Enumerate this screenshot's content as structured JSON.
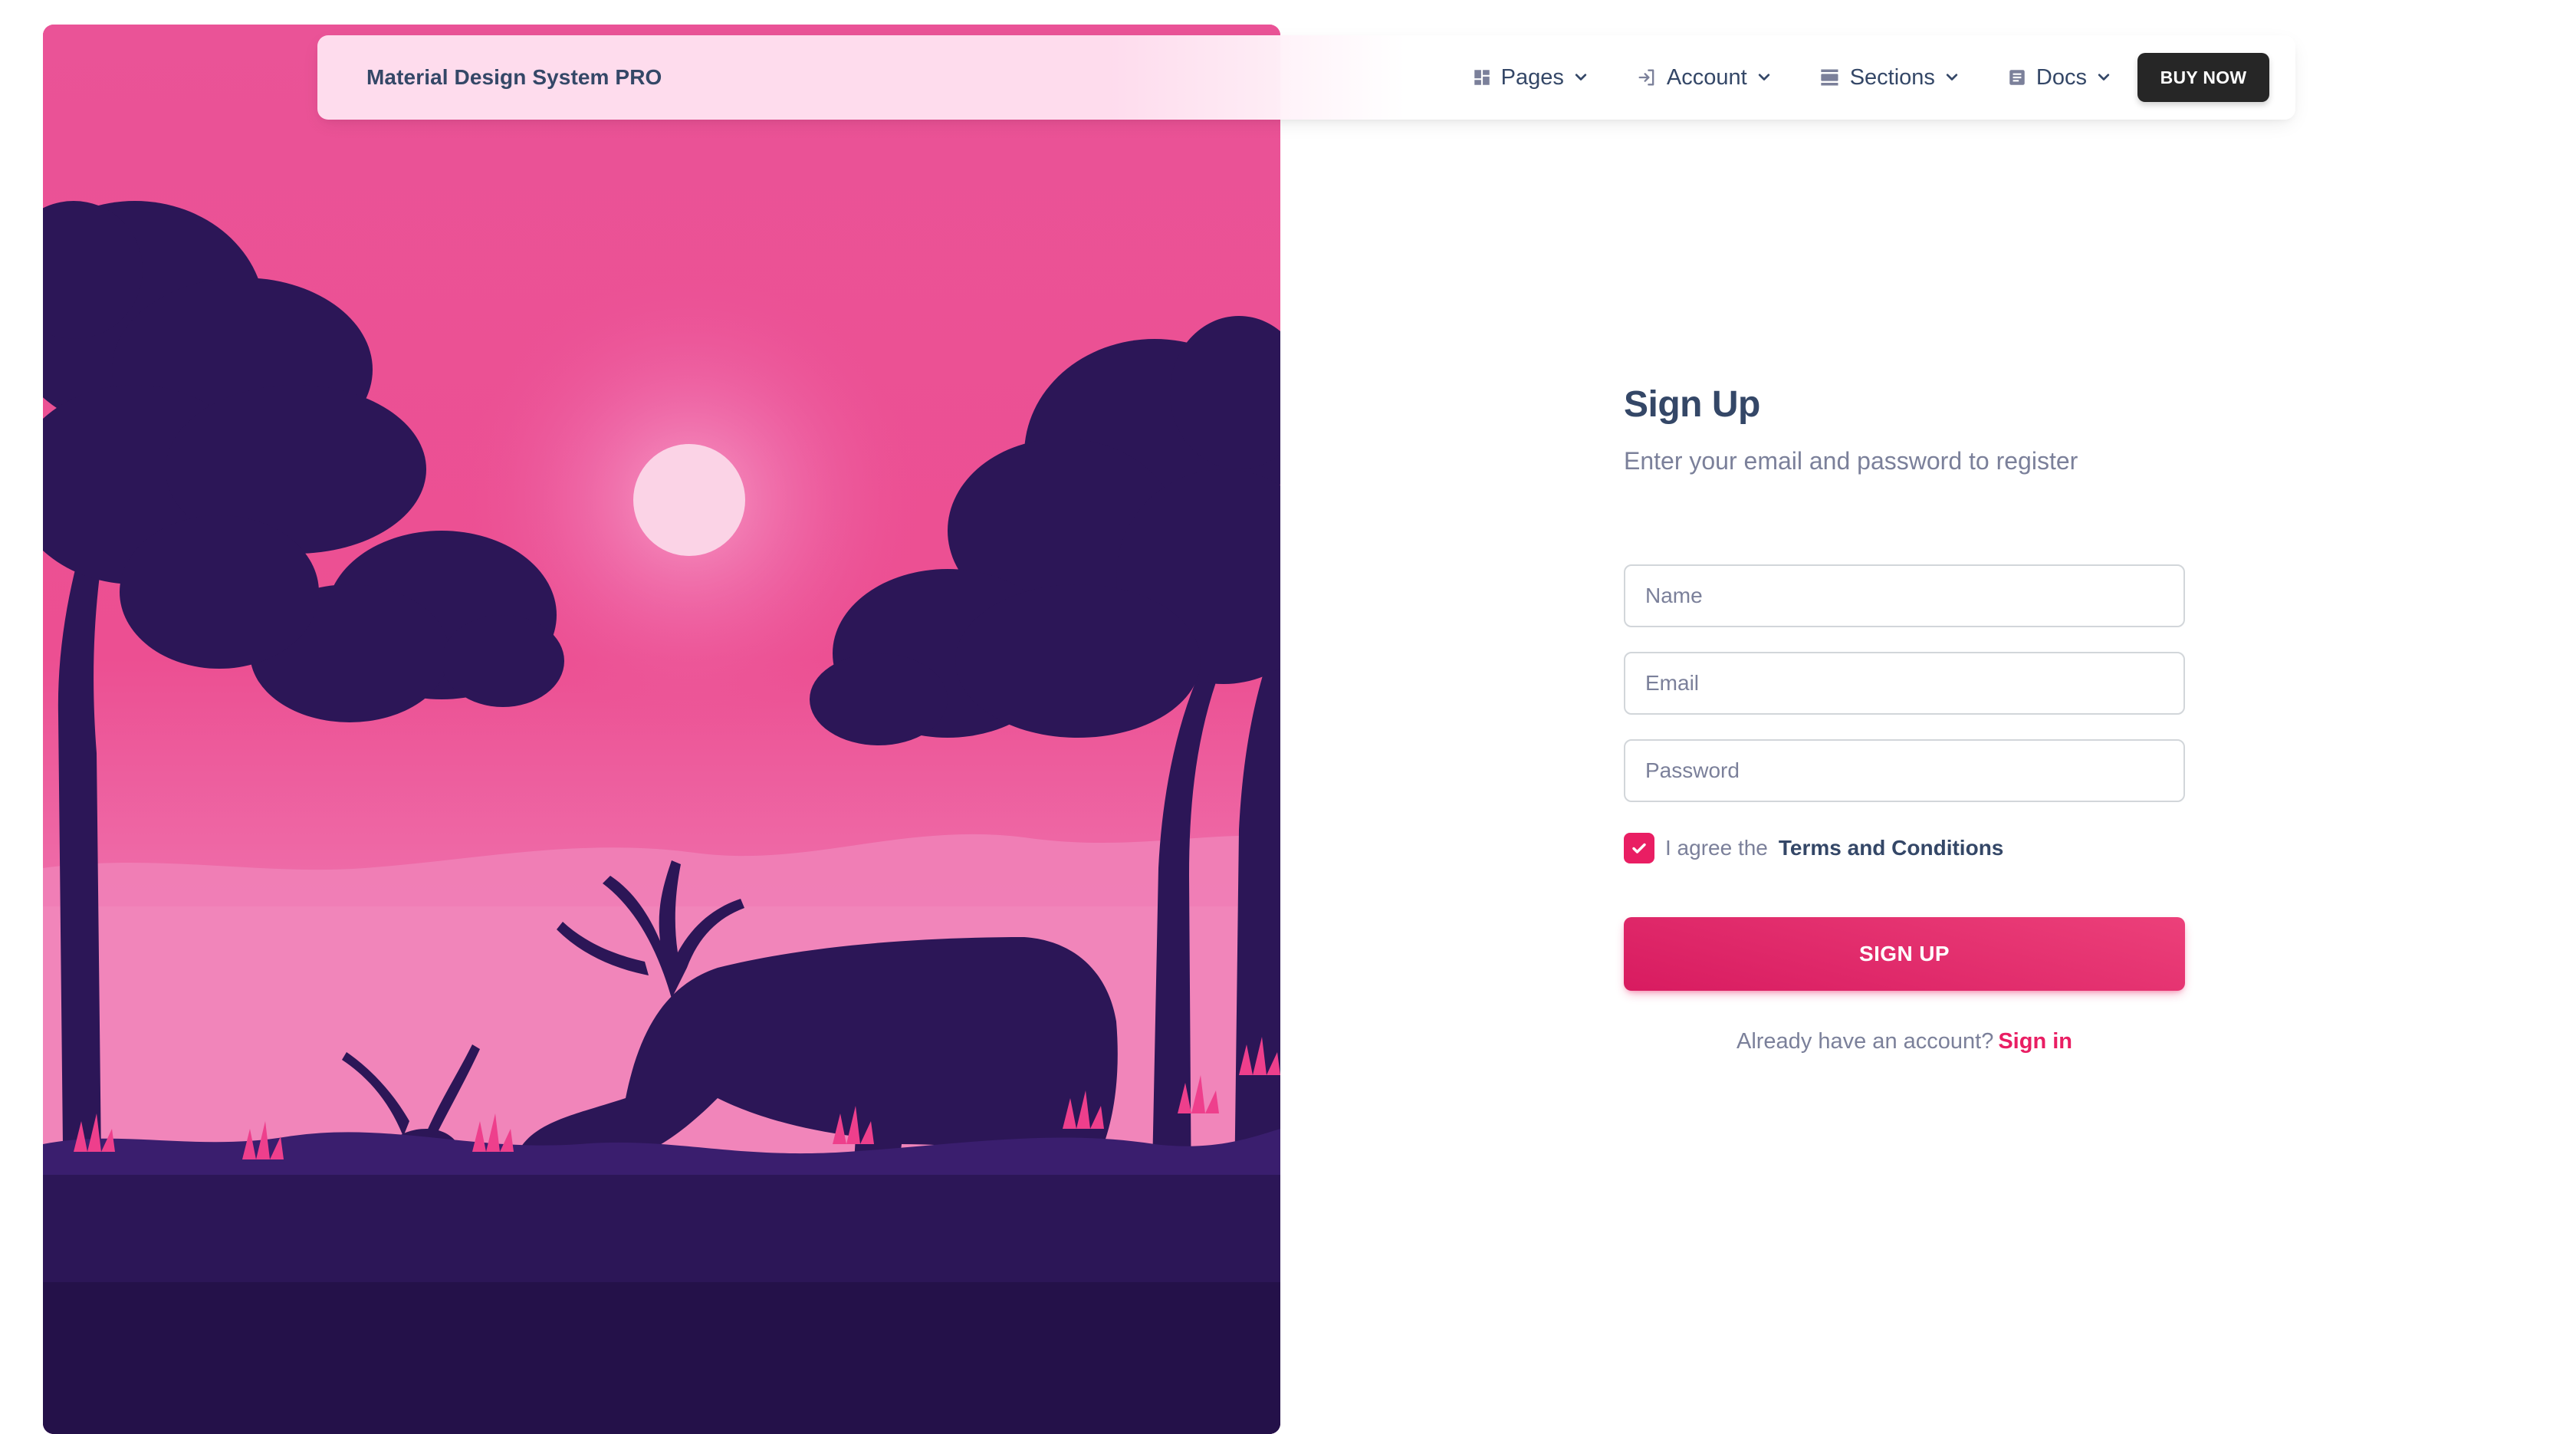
{
  "navbar": {
    "brand": "Material Design System PRO",
    "items": [
      {
        "label": "Pages",
        "icon": "dashboard-icon"
      },
      {
        "label": "Account",
        "icon": "login-icon"
      },
      {
        "label": "Sections",
        "icon": "view-day-icon"
      },
      {
        "label": "Docs",
        "icon": "article-icon"
      }
    ],
    "buy_label": "BUY NOW"
  },
  "form": {
    "title": "Sign Up",
    "subtitle": "Enter your email and password to register",
    "name_placeholder": "Name",
    "email_placeholder": "Email",
    "password_placeholder": "Password",
    "agree_text": "I agree the",
    "terms_label": "Terms and Conditions",
    "checked": true,
    "submit_label": "SIGN UP",
    "already_text": "Already have an account?",
    "signin_label": "Sign in"
  },
  "colors": {
    "primary": "#e91e63",
    "heading": "#344767",
    "muted": "#7b809a",
    "dark_button": "#262626",
    "illustration_sky": "#e94f93",
    "illustration_silhouette": "#2c1657"
  }
}
